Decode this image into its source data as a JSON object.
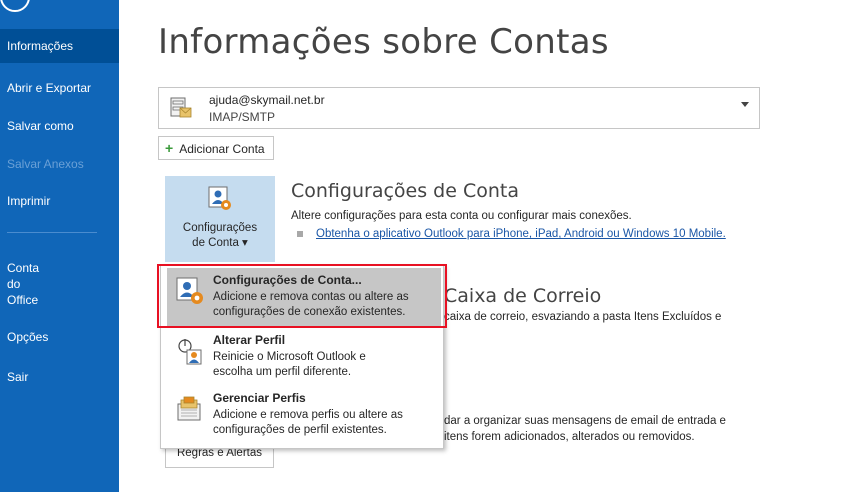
{
  "sidebar": {
    "items": [
      {
        "label": "Informações"
      },
      {
        "label": "Abrir e Exportar"
      },
      {
        "label": "Salvar como"
      },
      {
        "label": "Salvar Anexos"
      },
      {
        "label": "Imprimir"
      },
      {
        "label": "Conta do Office",
        "lines": [
          "Conta",
          "do",
          "Office"
        ]
      },
      {
        "label": "Opções"
      },
      {
        "label": "Sair"
      }
    ]
  },
  "main": {
    "title": "Informações sobre Contas",
    "account": {
      "email": "ajuda@skymail.net.br",
      "type": "IMAP/SMTP"
    },
    "add_account_label": "Adicionar Conta",
    "account_settings": {
      "button_lines": [
        "Configurações",
        "de Conta ▾"
      ],
      "title": "Configurações de Conta",
      "desc": "Altere configurações para esta conta ou configurar mais conexões.",
      "link": "Obtenha o aplicativo Outlook para iPhone, iPad, Android ou Windows 10 Mobile."
    },
    "mailbox": {
      "title": "Caixa de Correio",
      "desc": "caixa de correio, esvaziando a pasta Itens Excluídos e"
    },
    "rules": {
      "desc_line1": "dar a organizar suas mensagens de email de entrada e",
      "desc_line2": "itens forem adicionados, alterados ou removidos.",
      "button_label": "Regras e Alertas"
    }
  },
  "menu": {
    "items": [
      {
        "title": "Configurações de Conta...",
        "desc1": "Adicione e remova contas ou altere as",
        "desc2": "configurações de conexão existentes."
      },
      {
        "title": "Alterar Perfil",
        "desc1": "Reinicie o Microsoft Outlook e",
        "desc2": "escolha um perfil diferente."
      },
      {
        "title": "Gerenciar Perfis",
        "desc1": "Adicione e remova perfis ou altere as",
        "desc2": "configurações de perfil existentes."
      }
    ]
  },
  "colors": {
    "sidebar": "#1066b8",
    "sidebar_active": "#004f96",
    "highlight_box": "#e81123",
    "link": "#1a56a6"
  }
}
